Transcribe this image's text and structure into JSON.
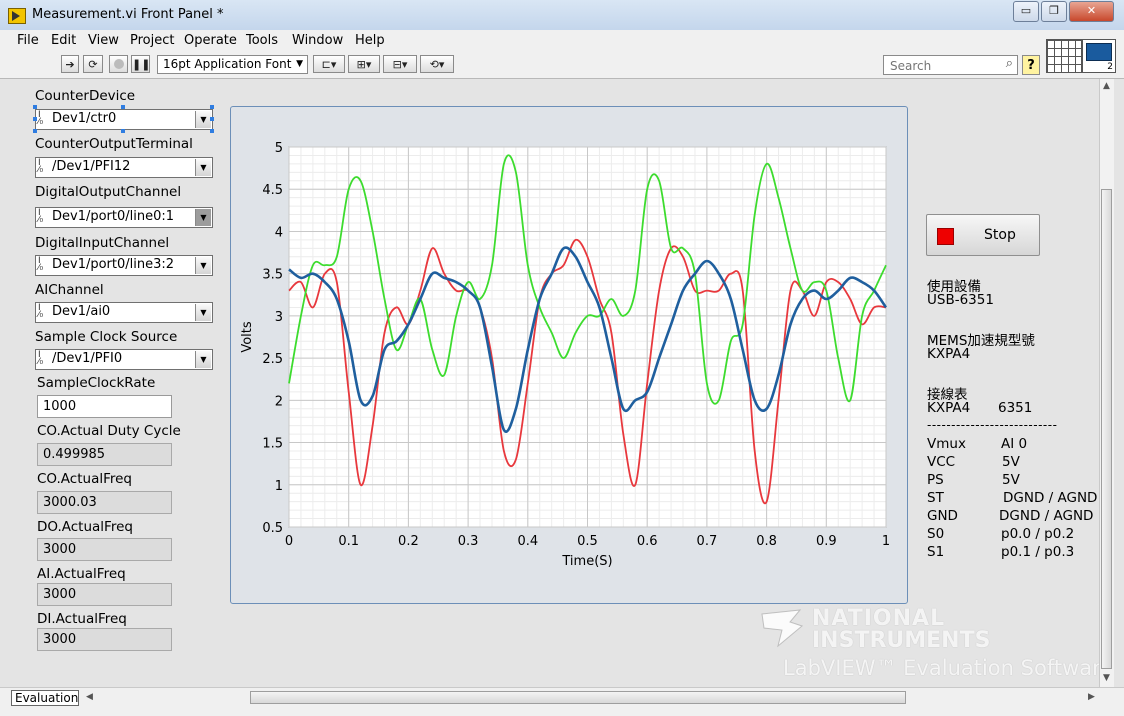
{
  "window": {
    "title": "Measurement.vi Front Panel *",
    "minimize": "▭",
    "restore": "❐",
    "close": "✕"
  },
  "menu": [
    "File",
    "Edit",
    "View",
    "Project",
    "Operate",
    "Tools",
    "Window",
    "Help"
  ],
  "toolbar": {
    "font": "16pt Application Font",
    "search_placeholder": "Search",
    "help": "?"
  },
  "controls": {
    "counter_device": {
      "label": "CounterDevice",
      "value": "Dev1/ctr0"
    },
    "counter_output_terminal": {
      "label": "CounterOutputTerminal",
      "value": "/Dev1/PFI12"
    },
    "digital_output_channel": {
      "label": "DigitalOutputChannel",
      "value": "Dev1/port0/line0:1"
    },
    "digital_input_channel": {
      "label": "DigitalInputChannel",
      "value": "Dev1/port0/line3:2"
    },
    "ai_channel": {
      "label": "AIChannel",
      "value": "Dev1/ai0"
    },
    "sample_clock_source": {
      "label": "Sample Clock Source",
      "value": "/Dev1/PFI0"
    },
    "sample_clock_rate": {
      "label": "SampleClockRate",
      "value": "1000"
    }
  },
  "indicators": {
    "co_duty": {
      "label": "CO.Actual Duty Cycle",
      "value": "0.499985"
    },
    "co_freq": {
      "label": "CO.ActualFreq",
      "value": "3000.03"
    },
    "do_freq": {
      "label": "DO.ActualFreq",
      "value": "3000"
    },
    "ai_freq": {
      "label": "AI.ActualFreq",
      "value": "3000"
    },
    "di_freq": {
      "label": "DI.ActualFreq",
      "value": "3000"
    }
  },
  "stop_button": {
    "label": "Stop"
  },
  "info": {
    "device_title": "使用設備",
    "device": "USB-6351",
    "mems_title": "MEMS加速規型號",
    "mems": "KXPA4",
    "wiring_title": "接線表",
    "wiring_header": [
      "KXPA4",
      "6351"
    ],
    "separator": "---------------------------",
    "rows": [
      [
        "Vmux",
        "AI 0"
      ],
      [
        "VCC",
        "5V"
      ],
      [
        "PS",
        "5V"
      ],
      [
        "ST",
        "DGND / AGND"
      ],
      [
        "GND",
        "DGND / AGND"
      ],
      [
        "S0",
        "p0.0 / p0.2"
      ],
      [
        "S1",
        "p0.1 / p0.3"
      ]
    ]
  },
  "watermark": {
    "line1": "NATIONAL",
    "line2": "INSTRUMENTS",
    "line3": "LabVIEW™ Evaluation Software"
  },
  "status": {
    "label": "Evaluation"
  },
  "colors": {
    "series_red": "#e8383d",
    "series_green": "#3ddc2e",
    "series_blue": "#1f5f9e",
    "grid_major": "#c8c8c8",
    "grid_minor": "#ececec"
  },
  "chart_data": {
    "type": "line",
    "xlabel": "Time(S)",
    "ylabel": "Volts",
    "xlim": [
      0,
      1
    ],
    "ylim": [
      0.5,
      5
    ],
    "xticks": [
      "0",
      "0.1",
      "0.2",
      "0.3",
      "0.4",
      "0.5",
      "0.6",
      "0.7",
      "0.8",
      "0.9",
      "1"
    ],
    "yticks": [
      "0.5",
      "1",
      "1.5",
      "2",
      "2.5",
      "3",
      "3.5",
      "4",
      "4.5",
      "5"
    ],
    "grid": true,
    "series": [
      {
        "color": "#e8383d",
        "x": [
          0,
          0.02,
          0.04,
          0.06,
          0.08,
          0.1,
          0.12,
          0.14,
          0.16,
          0.18,
          0.2,
          0.22,
          0.24,
          0.26,
          0.28,
          0.3,
          0.32,
          0.34,
          0.36,
          0.38,
          0.4,
          0.42,
          0.44,
          0.46,
          0.48,
          0.5,
          0.52,
          0.54,
          0.56,
          0.58,
          0.6,
          0.62,
          0.64,
          0.66,
          0.68,
          0.7,
          0.72,
          0.74,
          0.76,
          0.78,
          0.8,
          0.82,
          0.84,
          0.86,
          0.88,
          0.9,
          0.92,
          0.94,
          0.96,
          0.98,
          1.0
        ],
        "y": [
          3.3,
          3.4,
          3.1,
          3.5,
          3.4,
          2.1,
          1.0,
          1.7,
          2.8,
          3.1,
          2.9,
          3.3,
          3.8,
          3.5,
          3.3,
          3.3,
          3.1,
          2.5,
          1.4,
          1.3,
          2.2,
          3.2,
          3.5,
          3.6,
          3.9,
          3.7,
          3.2,
          2.8,
          1.6,
          1.0,
          2.2,
          3.3,
          3.8,
          3.7,
          3.3,
          3.3,
          3.3,
          3.5,
          3.3,
          1.4,
          0.8,
          2.0,
          3.3,
          3.3,
          3.0,
          3.4,
          3.4,
          3.2,
          2.9,
          3.1,
          3.1
        ]
      },
      {
        "color": "#3ddc2e",
        "x": [
          0,
          0.02,
          0.04,
          0.06,
          0.08,
          0.1,
          0.12,
          0.14,
          0.16,
          0.18,
          0.2,
          0.22,
          0.24,
          0.26,
          0.28,
          0.3,
          0.32,
          0.34,
          0.36,
          0.38,
          0.4,
          0.42,
          0.44,
          0.46,
          0.48,
          0.5,
          0.52,
          0.54,
          0.56,
          0.58,
          0.6,
          0.62,
          0.64,
          0.66,
          0.68,
          0.7,
          0.72,
          0.74,
          0.76,
          0.78,
          0.8,
          0.82,
          0.84,
          0.86,
          0.88,
          0.9,
          0.92,
          0.94,
          0.96,
          0.98,
          1.0
        ],
        "y": [
          2.2,
          3.0,
          3.6,
          3.6,
          3.7,
          4.5,
          4.6,
          4.0,
          3.2,
          2.6,
          2.9,
          3.2,
          2.6,
          2.3,
          3.0,
          3.4,
          3.2,
          3.6,
          4.8,
          4.7,
          3.6,
          3.1,
          2.8,
          2.5,
          2.8,
          3.0,
          3.0,
          3.2,
          3.0,
          3.3,
          4.5,
          4.6,
          3.8,
          3.8,
          3.5,
          2.2,
          2.0,
          2.7,
          2.9,
          4.2,
          4.8,
          4.4,
          3.8,
          3.3,
          3.4,
          3.3,
          2.5,
          2.0,
          3.0,
          3.3,
          3.6
        ]
      },
      {
        "color": "#1f5f9e",
        "x": [
          0,
          0.02,
          0.04,
          0.06,
          0.08,
          0.1,
          0.12,
          0.14,
          0.16,
          0.18,
          0.2,
          0.22,
          0.24,
          0.26,
          0.28,
          0.3,
          0.32,
          0.34,
          0.36,
          0.38,
          0.4,
          0.42,
          0.44,
          0.46,
          0.48,
          0.5,
          0.52,
          0.54,
          0.56,
          0.58,
          0.6,
          0.62,
          0.64,
          0.66,
          0.68,
          0.7,
          0.72,
          0.74,
          0.76,
          0.78,
          0.8,
          0.82,
          0.84,
          0.86,
          0.88,
          0.9,
          0.92,
          0.94,
          0.96,
          0.98,
          1.0
        ],
        "y": [
          3.55,
          3.45,
          3.5,
          3.4,
          3.2,
          2.7,
          2.0,
          2.05,
          2.6,
          2.7,
          2.9,
          3.2,
          3.5,
          3.45,
          3.4,
          3.3,
          3.1,
          2.4,
          1.65,
          1.9,
          2.6,
          3.2,
          3.5,
          3.8,
          3.7,
          3.4,
          3.1,
          2.5,
          1.9,
          2.0,
          2.1,
          2.5,
          2.9,
          3.3,
          3.5,
          3.65,
          3.5,
          3.2,
          2.6,
          2.0,
          1.9,
          2.3,
          2.9,
          3.2,
          3.3,
          3.2,
          3.3,
          3.45,
          3.4,
          3.3,
          3.1
        ]
      }
    ]
  }
}
